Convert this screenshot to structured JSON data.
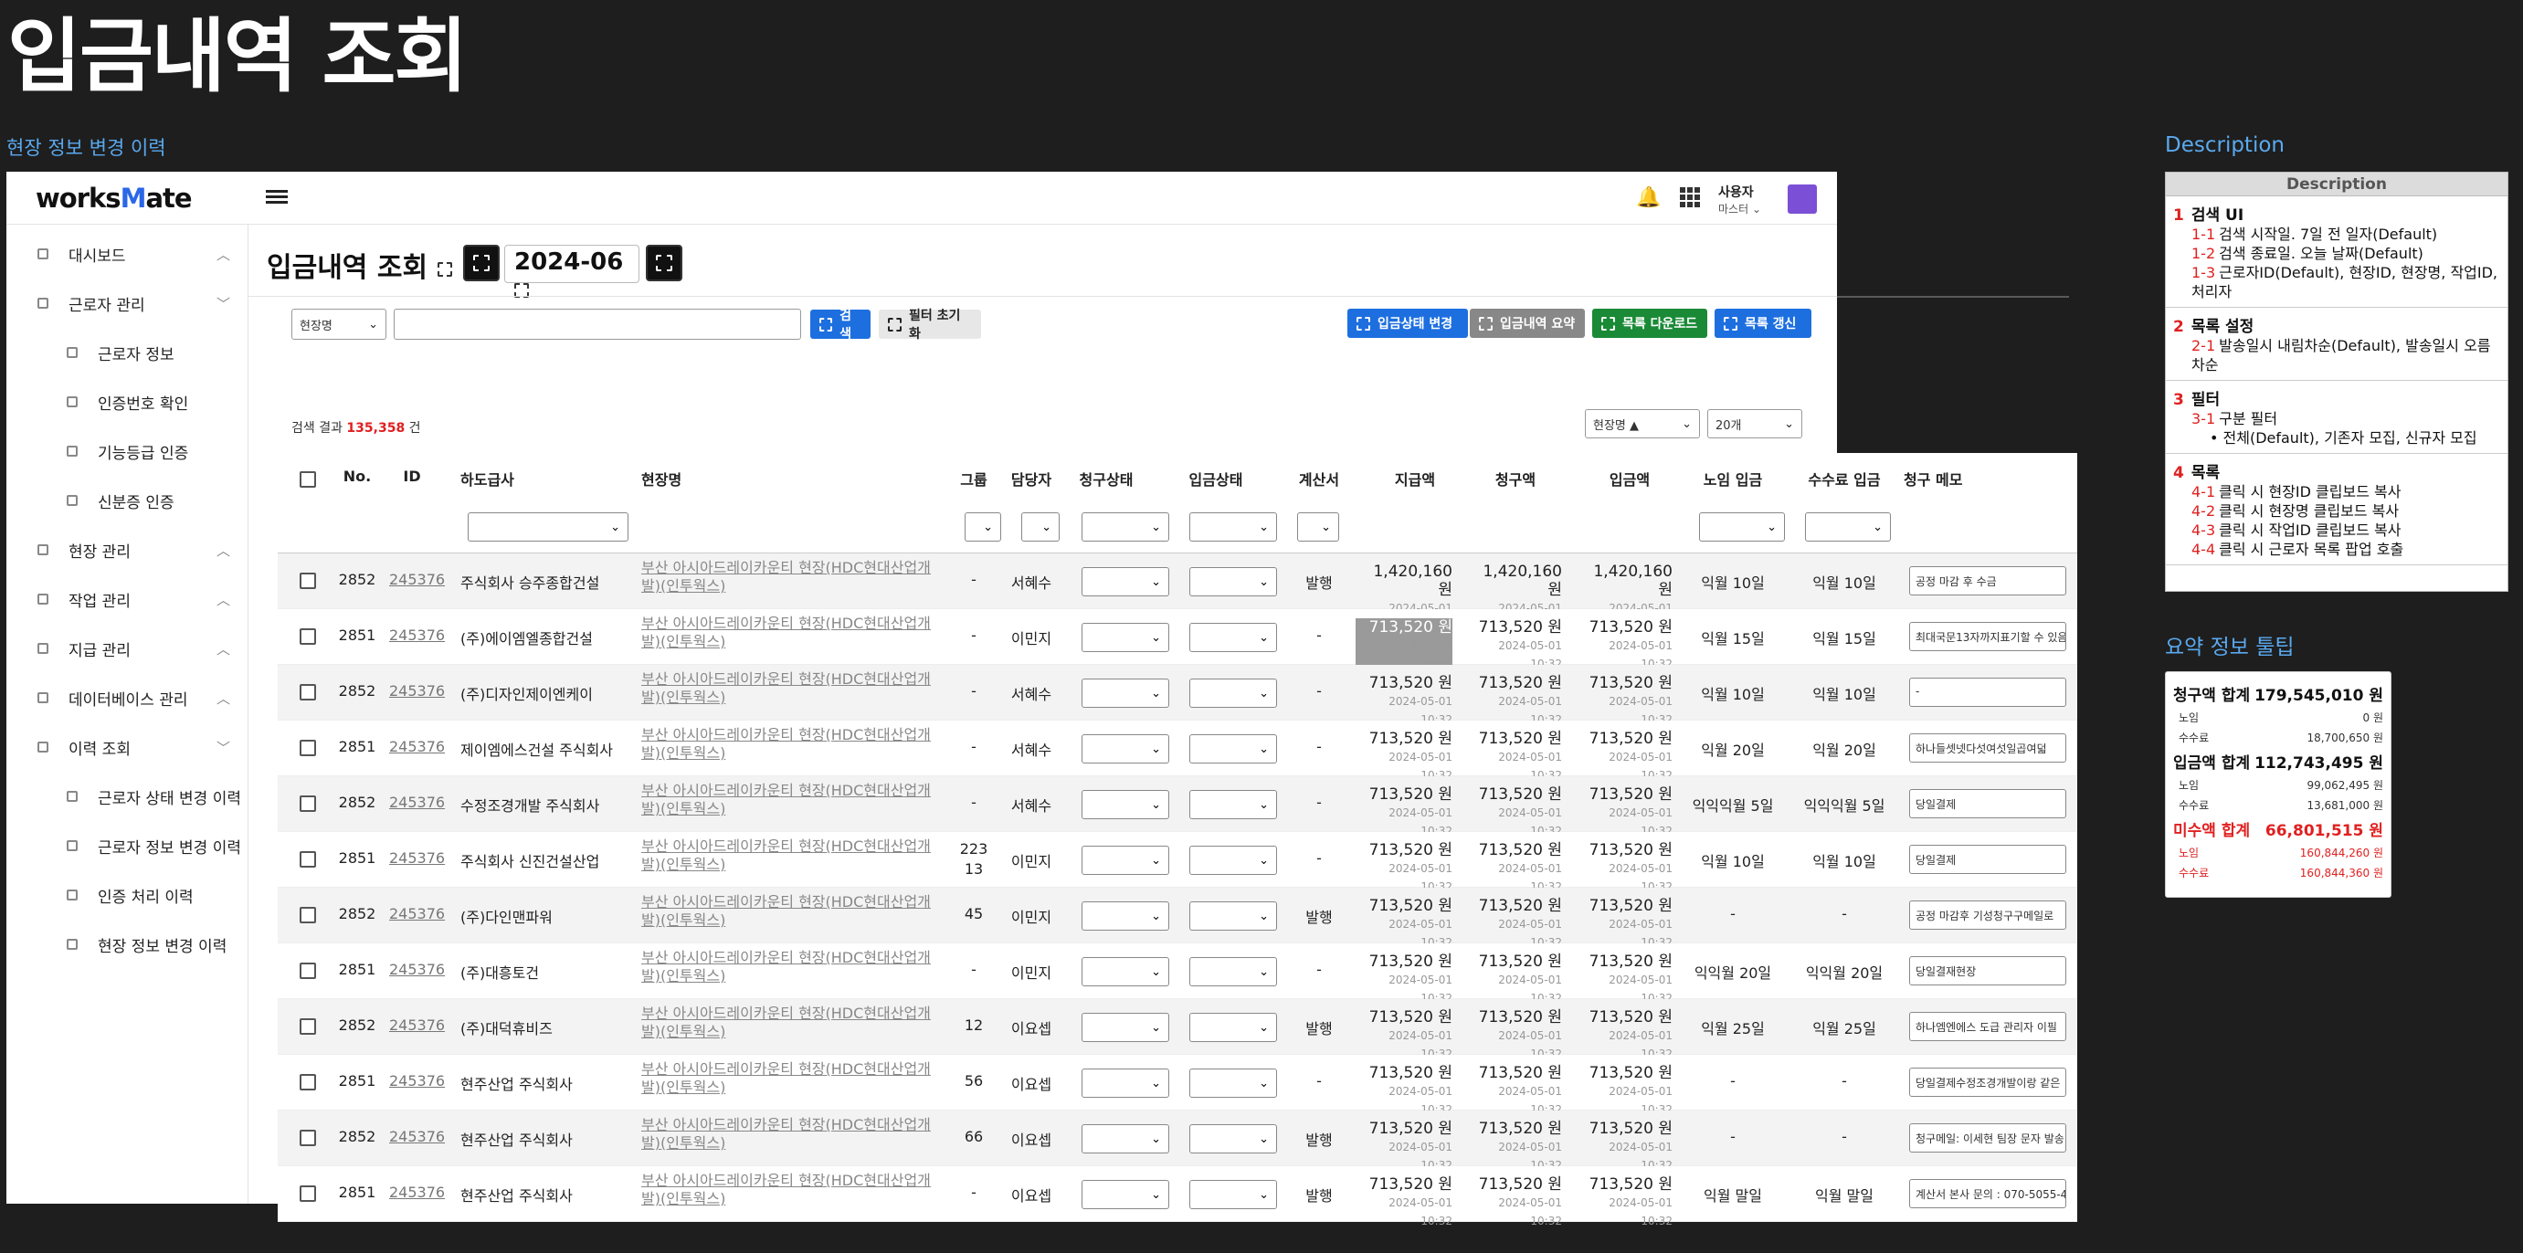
{
  "page_title": "입금내역 조회",
  "frame_label": "현장 정보 변경 이력",
  "desc_label": "Description",
  "tip_label": "요약 정보 툴팁",
  "app": {
    "logo_pre": "works",
    "logo_mid": "M",
    "logo_post": "ate",
    "user_name": "사용자",
    "user_role": "마스터",
    "sidebar": [
      {
        "label": "대시보드",
        "level": 0,
        "chev": "^"
      },
      {
        "label": "근로자 관리",
        "level": 0,
        "chev": "v"
      },
      {
        "label": "근로자 정보",
        "level": 1
      },
      {
        "label": "인증번호 확인",
        "level": 1
      },
      {
        "label": "기능등급 인증",
        "level": 1
      },
      {
        "label": "신분증 인증",
        "level": 1
      },
      {
        "label": "현장 관리",
        "level": 0,
        "chev": "^"
      },
      {
        "label": "작업 관리",
        "level": 0,
        "chev": "^"
      },
      {
        "label": "지급 관리",
        "level": 0,
        "chev": "^"
      },
      {
        "label": "데이터베이스 관리",
        "level": 0,
        "chev": "^"
      },
      {
        "label": "이력 조회",
        "level": 0,
        "chev": "v"
      },
      {
        "label": "근로자 상태 변경 이력",
        "level": 1
      },
      {
        "label": "근로자 정보 변경 이력",
        "level": 1
      },
      {
        "label": "인증 처리 이력",
        "level": 1
      },
      {
        "label": "현장 정보 변경 이력",
        "level": 1
      }
    ],
    "header": {
      "title": "입금내역 조회",
      "month": "2024-06"
    },
    "search": {
      "type_label": "현장명",
      "input_value": "",
      "search_label": "검색",
      "reset_label": "필터 초기화"
    },
    "actions": {
      "status": "입금상태 변경",
      "summary": "입금내역 요약",
      "download": "목록 다운로드",
      "refresh": "목록 갱신"
    },
    "result": {
      "prefix": "검색 결과 ",
      "count": "135,358",
      "suffix": " 건"
    },
    "sort_label": "현장명 ▲",
    "page_size": "20개",
    "columns": [
      "No.",
      "ID",
      "하도급사",
      "현장명",
      "그룹",
      "담당자",
      "청구상태",
      "입금상태",
      "계산서",
      "지급액",
      "청구액",
      "입금액",
      "노임 입금",
      "수수료 입금",
      "청구 메모"
    ],
    "rows": [
      {
        "no": "2852",
        "id": "245376",
        "sub": "주식회사 승주종합건설",
        "site": "부산 아시아드레이카운티 현장(HDC현대산업개발)(인투웍스)",
        "group": "-",
        "mgr": "서혜수",
        "tax": "발행",
        "pay": "1,420,160 원",
        "req": "1,420,160 원",
        "dep": "1,420,160 원",
        "date": "2024-05-01 10:32",
        "wage": "익월 10일",
        "fee": "익월 10일",
        "memo": "공정 마감 후 수금"
      },
      {
        "no": "2851",
        "id": "245376",
        "sub": "(주)에이엠엘종합건설",
        "site": "부산 아시아드레이카운티 현장(HDC현대산업개발)(인투웍스)",
        "group": "-",
        "mgr": "이민지",
        "tax": "-",
        "pay": "713,520 원",
        "req": "713,520 원",
        "dep": "713,520 원",
        "date": "2024-05-01 10:32",
        "wage": "익월 15일",
        "fee": "익월 15일",
        "memo": "최대국문13자까지표기할 수 있음",
        "hl": true
      },
      {
        "no": "2852",
        "id": "245376",
        "sub": "(주)디자인제이엔케이",
        "site": "부산 아시아드레이카운티 현장(HDC현대산업개발)(인투웍스)",
        "group": "-",
        "mgr": "서혜수",
        "tax": "-",
        "pay": "713,520 원",
        "req": "713,520 원",
        "dep": "713,520 원",
        "date": "2024-05-01 10:32",
        "wage": "익월 10일",
        "fee": "익월 10일",
        "memo": "-"
      },
      {
        "no": "2851",
        "id": "245376",
        "sub": "제이엠에스건설 주식회사",
        "site": "부산 아시아드레이카운티 현장(HDC현대산업개발)(인투웍스)",
        "group": "-",
        "mgr": "서혜수",
        "tax": "-",
        "pay": "713,520 원",
        "req": "713,520 원",
        "dep": "713,520 원",
        "date": "2024-05-01 10:32",
        "wage": "익월 20일",
        "fee": "익월 20일",
        "memo": "하나들셋넷다섯여섯일곱여덟"
      },
      {
        "no": "2852",
        "id": "245376",
        "sub": "수정조경개발 주식회사",
        "site": "부산 아시아드레이카운티 현장(HDC현대산업개발)(인투웍스)",
        "group": "-",
        "mgr": "서혜수",
        "tax": "-",
        "pay": "713,520 원",
        "req": "713,520 원",
        "dep": "713,520 원",
        "date": "2024-05-01 10:32",
        "wage": "익익익월 5일",
        "fee": "익익익월 5일",
        "memo": "당일결제"
      },
      {
        "no": "2851",
        "id": "245376",
        "sub": "주식회사 신진건설산업",
        "site": "부산 아시아드레이카운티 현장(HDC현대산업개발)(인투웍스)",
        "group": "223\n13",
        "mgr": "이민지",
        "tax": "-",
        "pay": "713,520 원",
        "req": "713,520 원",
        "dep": "713,520 원",
        "date": "2024-05-01 10:32",
        "wage": "익월 10일",
        "fee": "익월 10일",
        "memo": "당일결제"
      },
      {
        "no": "2852",
        "id": "245376",
        "sub": "(주)다인맨파워",
        "site": "부산 아시아드레이카운티 현장(HDC현대산업개발)(인투웍스)",
        "group": "45",
        "mgr": "이민지",
        "tax": "발행",
        "pay": "713,520 원",
        "req": "713,520 원",
        "dep": "713,520 원",
        "date": "2024-05-01 10:32",
        "wage": "-",
        "fee": "-",
        "memo": "공정 마감후 기성청구구메일로"
      },
      {
        "no": "2851",
        "id": "245376",
        "sub": "(주)대흥토건",
        "site": "부산 아시아드레이카운티 현장(HDC현대산업개발)(인투웍스)",
        "group": "-",
        "mgr": "이민지",
        "tax": "-",
        "pay": "713,520 원",
        "req": "713,520 원",
        "dep": "713,520 원",
        "date": "2024-05-01 10:32",
        "wage": "익익월 20일",
        "fee": "익익월 20일",
        "memo": "당일결재현장"
      },
      {
        "no": "2852",
        "id": "245376",
        "sub": "(주)대덕휴비즈",
        "site": "부산 아시아드레이카운티 현장(HDC현대산업개발)(인투웍스)",
        "group": "12",
        "mgr": "이요셉",
        "tax": "발행",
        "pay": "713,520 원",
        "req": "713,520 원",
        "dep": "713,520 원",
        "date": "2024-05-01 10:32",
        "wage": "익월 25일",
        "fee": "익월 25일",
        "memo": "하나엠엔에스 도급 관리자 이필"
      },
      {
        "no": "2851",
        "id": "245376",
        "sub": "현주산업 주식회사",
        "site": "부산 아시아드레이카운티 현장(HDC현대산업개발)(인투웍스)",
        "group": "56",
        "mgr": "이요셉",
        "tax": "-",
        "pay": "713,520 원",
        "req": "713,520 원",
        "dep": "713,520 원",
        "date": "2024-05-01 10:32",
        "wage": "-",
        "fee": "-",
        "memo": "당일결제수정조경개발이랑 같은"
      },
      {
        "no": "2852",
        "id": "245376",
        "sub": "현주산업 주식회사",
        "site": "부산 아시아드레이카운티 현장(HDC현대산업개발)(인투웍스)",
        "group": "66",
        "mgr": "이요셉",
        "tax": "발행",
        "pay": "713,520 원",
        "req": "713,520 원",
        "dep": "713,520 원",
        "date": "2024-05-01 10:32",
        "wage": "-",
        "fee": "-",
        "memo": "청구메일: 이세현 팀장 문자 발송"
      },
      {
        "no": "2851",
        "id": "245376",
        "sub": "현주산업 주식회사",
        "site": "부산 아시아드레이카운티 현장(HDC현대산업개발)(인투웍스)",
        "group": "-",
        "mgr": "이요셉",
        "tax": "발행",
        "pay": "713,520 원",
        "req": "713,520 원",
        "dep": "713,520 원",
        "date": "2024-05-01 10:32",
        "wage": "익월 말일",
        "fee": "익월 말일",
        "memo": "계산서 본사 문의 : 070-5055-4"
      }
    ]
  },
  "description": {
    "head": "Description",
    "sections": [
      {
        "num": "1",
        "title": "검색 UI",
        "items": [
          {
            "n": "1-1",
            "t": "검색 시작일. 7일 전 일자(Default)"
          },
          {
            "n": "1-2",
            "t": "검색 종료일. 오늘 날짜(Default)"
          },
          {
            "n": "1-3",
            "t": "근로자ID(Default), 현장ID, 현장명, 작업ID, 처리자"
          }
        ]
      },
      {
        "num": "2",
        "title": "목록 설정",
        "items": [
          {
            "n": "2-1",
            "t": "발송일시 내림차순(Default), 발송일시 오름차순"
          }
        ]
      },
      {
        "num": "3",
        "title": "필터",
        "items": [
          {
            "n": "3-1",
            "t": "구분 필터"
          },
          {
            "n": "",
            "t": "• 전체(Default), 기존자 모집, 신규자 모집"
          }
        ]
      },
      {
        "num": "4",
        "title": "목록",
        "items": [
          {
            "n": "4-1",
            "t": "클릭 시 현장ID 클립보드 복사"
          },
          {
            "n": "4-2",
            "t": "클릭 시 현장명 클립보드 복사"
          },
          {
            "n": "4-3",
            "t": "클릭 시 작업ID 클립보드 복사"
          },
          {
            "n": "4-4",
            "t": "클릭 시 근로자 목록 팝업 호출"
          }
        ]
      }
    ]
  },
  "tooltip": [
    {
      "type": "main",
      "label": "청구액 합계",
      "value": "179,545,010 원"
    },
    {
      "type": "sub",
      "label": "노임",
      "value": "0 원"
    },
    {
      "type": "sub",
      "label": "수수료",
      "value": "18,700,650 원"
    },
    {
      "type": "main",
      "label": "입금액 합계",
      "value": "112,743,495 원"
    },
    {
      "type": "sub",
      "label": "노임",
      "value": "99,062,495 원"
    },
    {
      "type": "sub",
      "label": "수수료",
      "value": "13,681,000 원"
    },
    {
      "type": "main",
      "label": "미수액 합계",
      "value": "66,801,515 원",
      "red": true
    },
    {
      "type": "sub",
      "label": "노임",
      "value": "160,844,260 원",
      "red": true
    },
    {
      "type": "sub",
      "label": "수수료",
      "value": "160,844,360 원",
      "red": true
    }
  ],
  "colors": {
    "accent": "#1d6fe0",
    "green": "#1a8a36",
    "red": "#e02020",
    "avatar": "#7b4fd6"
  }
}
